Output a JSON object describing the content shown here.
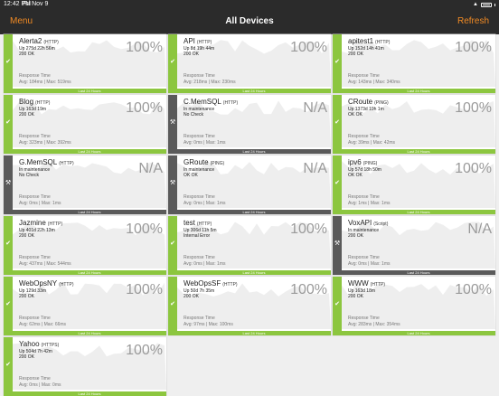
{
  "status_bar": {
    "time": "12:42 PM",
    "date": "Fri Nov 9"
  },
  "navbar": {
    "menu_label": "Menu",
    "title": "All Devices",
    "refresh_label": "Refresh"
  },
  "devices": [
    {
      "name": "Alerta2",
      "protocol": "(HTTP)",
      "line1": "Up 275d 22h 56m",
      "line2": "200 OK",
      "percent": "100%",
      "rt_label": "Response Time",
      "avg_max": "Avg: 184ms | Max: 519ms",
      "footer": "Last 24 Hours",
      "state": "up",
      "status_icon": "check-icon"
    },
    {
      "name": "API",
      "protocol": "(HTTP)",
      "line1": "Up 8d 19h 44m",
      "line2": "200 OK",
      "percent": "100%",
      "rt_label": "Response Time",
      "avg_max": "Avg: 218ms | Max: 230ms",
      "footer": "Last 24 Hours",
      "state": "up",
      "status_icon": "check-icon"
    },
    {
      "name": "apitest1",
      "protocol": "(HTTP)",
      "line1": "Up 152d 14h 41m",
      "line2": "200 OK",
      "percent": "100%",
      "rt_label": "Response Time",
      "avg_max": "Avg: 143ms | Max: 340ms",
      "footer": "Last 24 Hours",
      "state": "up",
      "status_icon": "check-icon"
    },
    {
      "name": "Blog",
      "protocol": "(HTTP)",
      "line1": "Up 163d 19m",
      "line2": "200 OK",
      "percent": "100%",
      "rt_label": "Response Time",
      "avg_max": "Avg: 323ms | Max: 392ms",
      "footer": "Last 24 Hours",
      "state": "up",
      "status_icon": "check-icon"
    },
    {
      "name": "C.MemSQL",
      "protocol": "(HTTP)",
      "line1": "In maintenance",
      "line2": "No Check",
      "percent": "N/A",
      "rt_label": "Response Time",
      "avg_max": "Avg: 0ms | Max: 1ms",
      "footer": "Last 24 Hours",
      "state": "maint",
      "status_icon": "wrench-icon"
    },
    {
      "name": "CRoute",
      "protocol": "(PING)",
      "line1": "Up 1373d 19h 1m",
      "line2": "OK OK",
      "percent": "100%",
      "rt_label": "Response Time",
      "avg_max": "Avg: 39ms | Max: 42ms",
      "footer": "Last 24 Hours",
      "state": "up",
      "status_icon": "check-icon"
    },
    {
      "name": "G.MemSQL",
      "protocol": "(HTTP)",
      "line1": "In maintenance",
      "line2": "No Check",
      "percent": "N/A",
      "rt_label": "Response Time",
      "avg_max": "Avg: 0ms | Max: 1ms",
      "footer": "Last 24 Hours",
      "state": "maint",
      "status_icon": "wrench-icon"
    },
    {
      "name": "GRoute",
      "protocol": "(PING)",
      "line1": "In maintenance",
      "line2": "OK OK",
      "percent": "N/A",
      "rt_label": "Response Time",
      "avg_max": "Avg: 0ms | Max: 1ms",
      "footer": "Last 24 Hours",
      "state": "maint",
      "status_icon": "wrench-icon"
    },
    {
      "name": "ipv6",
      "protocol": "(PING)",
      "line1": "Up 57d 18h 50m",
      "line2": "OK OK",
      "percent": "100%",
      "rt_label": "Response Time",
      "avg_max": "Avg: 1ms | Max: 1ms",
      "footer": "Last 24 Hours",
      "state": "up",
      "status_icon": "check-icon"
    },
    {
      "name": "Jazmine",
      "protocol": "(HTTP)",
      "line1": "Up 401d 22h 13m",
      "line2": "200 OK",
      "percent": "100%",
      "rt_label": "Response Time",
      "avg_max": "Avg: 437ms | Max: 544ms",
      "footer": "Last 24 Hours",
      "state": "up",
      "status_icon": "check-icon"
    },
    {
      "name": "test",
      "protocol": "(HTTP)",
      "line1": "Up 306d 11h 5m",
      "line2": "Internal Error",
      "percent": "100%",
      "rt_label": "Response Time",
      "avg_max": "Avg: 0ms | Max: 1ms",
      "footer": "Last 24 Hours",
      "state": "up",
      "status_icon": "check-icon"
    },
    {
      "name": "VoxAPI",
      "protocol": "(Script)",
      "line1": "In maintenance",
      "line2": "200 OK",
      "percent": "N/A",
      "rt_label": "Response Time",
      "avg_max": "Avg: 0ms | Max: 1ms",
      "footer": "Last 24 Hours",
      "state": "maint",
      "status_icon": "wrench-icon"
    },
    {
      "name": "WebOpsNY",
      "protocol": "(HTTP)",
      "line1": "Up 129d 33m",
      "line2": "200 OK",
      "percent": "100%",
      "rt_label": "Response Time",
      "avg_max": "Avg: 62ms | Max: 66ms",
      "footer": "Last 24 Hours",
      "state": "up",
      "status_icon": "check-icon"
    },
    {
      "name": "WebOpsSF",
      "protocol": "(HTTP)",
      "line1": "Up 50d 7h 35m",
      "line2": "200 OK",
      "percent": "100%",
      "rt_label": "Response Time",
      "avg_max": "Avg: 97ms | Max: 100ms",
      "footer": "Last 24 Hours",
      "state": "up",
      "status_icon": "check-icon"
    },
    {
      "name": "WWW",
      "protocol": "(HTTP)",
      "line1": "Up 163d 18m",
      "line2": "200 OK",
      "percent": "100%",
      "rt_label": "Response Time",
      "avg_max": "Avg: 283ms | Max: 354ms",
      "footer": "Last 24 Hours",
      "state": "up",
      "status_icon": "check-icon"
    },
    {
      "name": "Yahoo",
      "protocol": "(HTTPS)",
      "line1": "Up 504d 7h 42m",
      "line2": "200 OK",
      "percent": "100%",
      "rt_label": "Response Time",
      "avg_max": "Avg: 0ms | Max: 0ms",
      "footer": "Last 24 Hours",
      "state": "up",
      "status_icon": "check-icon"
    }
  ],
  "colors": {
    "up": "#8cc63f",
    "maintenance": "#5a5a5a",
    "accent": "#f08a24",
    "navbar": "#2b2b2b"
  }
}
